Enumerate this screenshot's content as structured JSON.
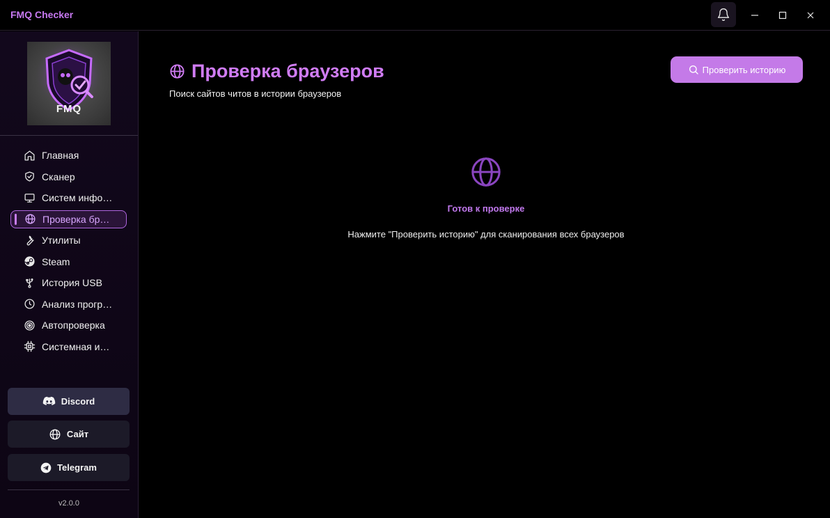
{
  "window": {
    "title": "FMQ Checker",
    "controls": {
      "notifications": "bell-icon",
      "minimize": "minimize-icon",
      "maximize": "maximize-icon",
      "close": "close-icon"
    }
  },
  "sidebar": {
    "logo_text": "FMQ",
    "nav": [
      {
        "label": "Главная",
        "icon": "home-icon"
      },
      {
        "label": "Сканер",
        "icon": "shield-check-icon"
      },
      {
        "label": "Систем инфо…",
        "icon": "monitor-icon"
      },
      {
        "label": "Проверка бр…",
        "icon": "globe-icon",
        "active": true
      },
      {
        "label": "Утилиты",
        "icon": "wrench-icon"
      },
      {
        "label": "Steam",
        "icon": "steam-icon"
      },
      {
        "label": "История USB",
        "icon": "usb-icon"
      },
      {
        "label": "Анализ прогр…",
        "icon": "clock-icon"
      },
      {
        "label": "Автопроверка",
        "icon": "target-icon"
      },
      {
        "label": "Системная и…",
        "icon": "cpu-icon"
      }
    ],
    "links": [
      {
        "label": "Discord",
        "icon": "discord-icon"
      },
      {
        "label": "Сайт",
        "icon": "globe-icon"
      },
      {
        "label": "Telegram",
        "icon": "telegram-icon"
      }
    ],
    "version": "v2.0.0"
  },
  "main": {
    "title": "Проверка браузеров",
    "subtitle": "Поиск сайтов читов в истории браузеров",
    "action_button": "Проверить историю",
    "empty_state": {
      "title": "Готов к проверке",
      "description": "Нажмите \"Проверить историю\" для сканирования всех браузеров"
    }
  },
  "colors": {
    "accent": "#c47ae8",
    "accent_text": "#d07cf4",
    "background": "#000000",
    "sidebar": "#12081c"
  }
}
